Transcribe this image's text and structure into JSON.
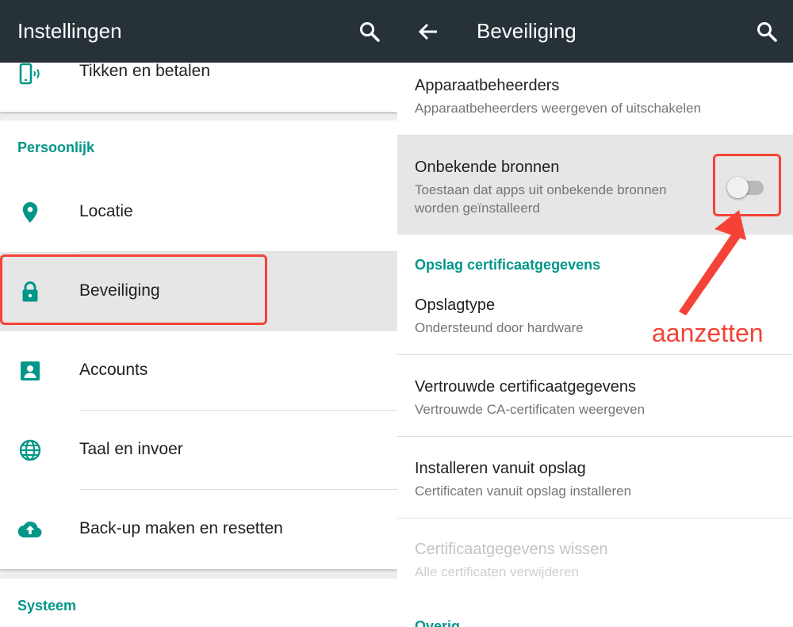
{
  "left_panel": {
    "appbar": {
      "title": "Instellingen",
      "search_icon": "search-icon"
    },
    "tap_pay_row": {
      "label": "Tikken en betalen",
      "icon": "nfc-phone-icon"
    },
    "section_personal": "Persoonlijk",
    "items": [
      {
        "label": "Locatie",
        "icon": "location-pin-icon"
      },
      {
        "label": "Beveiliging",
        "icon": "lock-icon",
        "highlighted": true
      },
      {
        "label": "Accounts",
        "icon": "account-icon"
      },
      {
        "label": "Taal en invoer",
        "icon": "globe-icon"
      },
      {
        "label": "Back-up maken en resetten",
        "icon": "cloud-upload-icon"
      }
    ],
    "section_system": "Systeem"
  },
  "right_panel": {
    "appbar": {
      "title": "Beveiliging",
      "back_icon": "arrow-back-icon",
      "search_icon": "search-icon"
    },
    "prefs": [
      {
        "title": "Apparaatbeheerders",
        "summary": "Apparaatbeheerders weergeven of uitschakelen"
      },
      {
        "title": "Onbekende bronnen",
        "summary_line1": "Toestaan dat apps uit onbekende bronnen",
        "summary_line2": "worden geïnstalleerd",
        "switch_on": false
      }
    ],
    "section_storage": "Opslag certificaatgegevens",
    "storage_prefs": [
      {
        "title": "Opslagtype",
        "summary": "Ondersteund door hardware"
      },
      {
        "title": "Vertrouwde certificaatgegevens",
        "summary": "Vertrouwde CA-certificaten weergeven"
      },
      {
        "title": "Installeren vanuit opslag",
        "summary": "Certificaten vanuit opslag installeren"
      },
      {
        "title": "Certificaatgegevens wissen",
        "summary": "Alle certificaten verwijderen",
        "disabled": true
      }
    ],
    "section_other": "Overig"
  },
  "annotation": {
    "text": "aanzetten",
    "color": "#f44336"
  },
  "colors": {
    "appbar": "#263238",
    "accent": "#009688",
    "highlight": "#e6e6e6"
  }
}
